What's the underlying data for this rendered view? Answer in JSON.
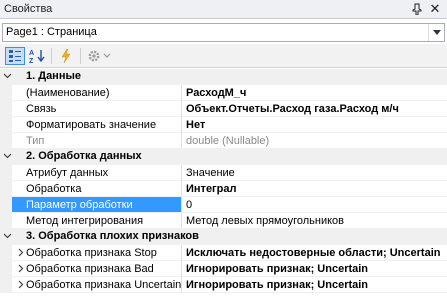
{
  "window": {
    "title": "Свойства"
  },
  "object_selector": {
    "value": "Page1 : Страница"
  },
  "toolbar": {
    "buttons": [
      {
        "name": "categorized-icon",
        "active": true
      },
      {
        "name": "alphabetical-icon",
        "active": false
      },
      {
        "name": "events-icon",
        "active": false
      },
      {
        "name": "gear-icon",
        "active": false
      }
    ]
  },
  "categories": [
    {
      "label": "1. Данные",
      "props": [
        {
          "name": "(Наименование)",
          "value": "РасходМ_ч",
          "bold": true
        },
        {
          "name": "Связь",
          "value": "Объект.Отчеты.Расход газа.Расход м/ч",
          "bold": true
        },
        {
          "name": "Форматировать значение",
          "value": "Нет",
          "bold": true
        },
        {
          "name": "Тип",
          "value": "double (Nullable)",
          "gray": true
        }
      ]
    },
    {
      "label": "2. Обработка данных",
      "props": [
        {
          "name": "Атрибут данных",
          "value": "Значение"
        },
        {
          "name": "Обработка",
          "value": "Интеграл",
          "bold": true
        },
        {
          "name": "Параметр обработки",
          "value": "0",
          "selected": true
        },
        {
          "name": "Метод интегрирования",
          "value": "Метод левых прямоугольников"
        }
      ]
    },
    {
      "label": "3. Обработка плохих признаков",
      "props": [
        {
          "name": "Обработка признака Stop",
          "value": "Исключать недостоверные области; Uncertain",
          "bold": true
        },
        {
          "name": "Обработка признака Bad",
          "value": "Игнорировать признак; Uncertain",
          "bold": true
        },
        {
          "name": "Обработка признака Uncertain",
          "value": "Игнорировать признак; Uncertain",
          "bold": true
        }
      ]
    }
  ]
}
